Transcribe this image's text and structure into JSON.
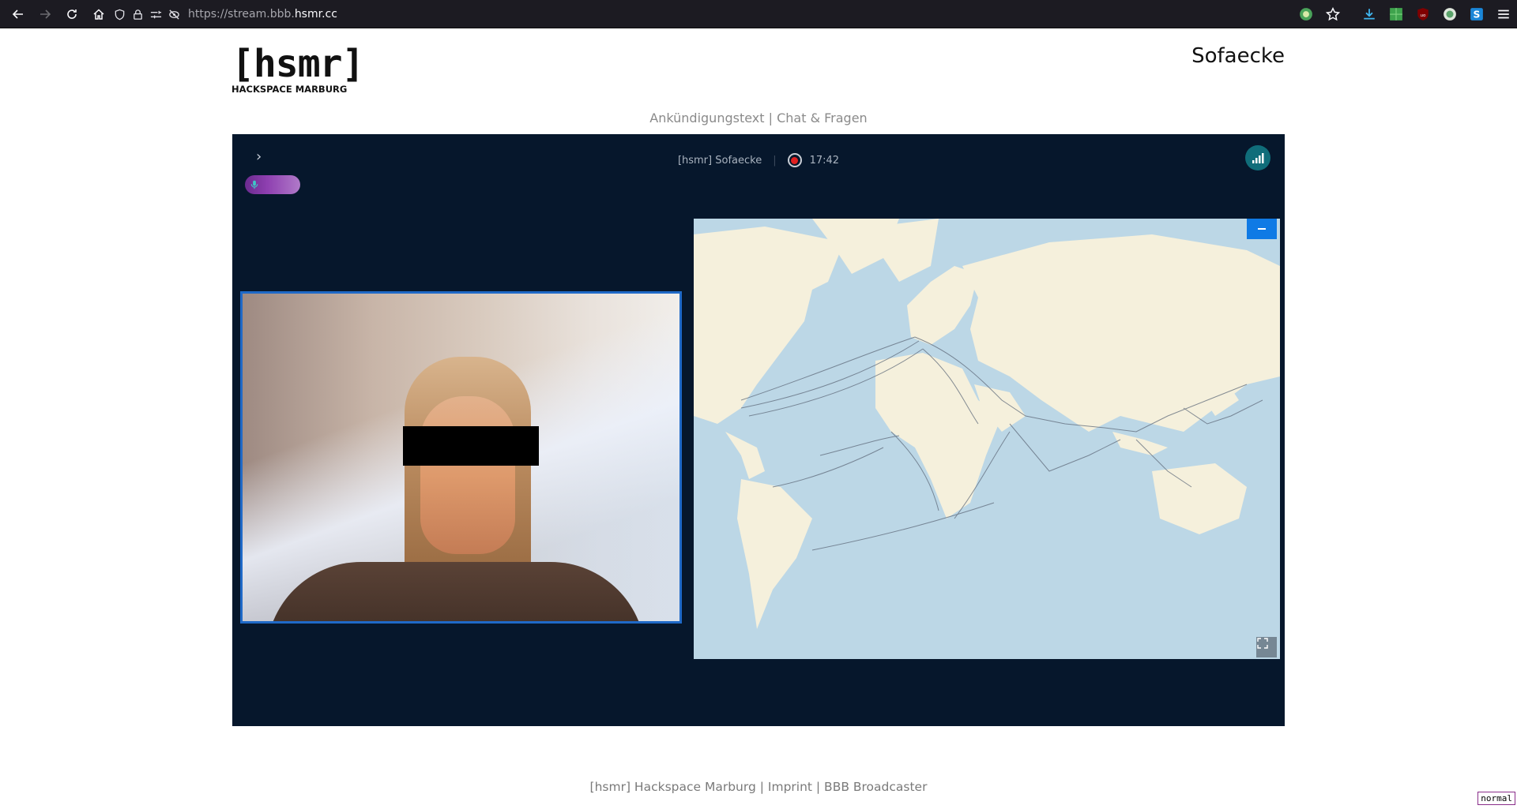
{
  "browser": {
    "url_prefix": "https://stream.bbb.",
    "url_host": "hsmr.cc"
  },
  "site": {
    "logo_mark": "[hsmr]",
    "logo_sub": "HACKSPACE MARBURG",
    "room_title": "Sofaecke"
  },
  "subnav": {
    "item1": "Ankündigungstext",
    "separator": " | ",
    "item2": "Chat & Fragen"
  },
  "stream": {
    "meeting_name": "[hsmr] Sofaecke",
    "recording_time": "17:42",
    "recording_color": "#e02020",
    "connection_color": "#106d7a"
  },
  "footer": {
    "text": "[hsmr] Hackspace Marburg | Imprint | BBB Broadcaster"
  },
  "badge": {
    "mode": "normal"
  },
  "icons": {
    "back": "arrow-left-icon",
    "forward": "arrow-right-icon",
    "reload": "reload-icon",
    "home": "home-icon",
    "shield": "shield-icon",
    "lock": "lock-icon",
    "permissions": "permissions-icon",
    "tracking": "tracking-off-icon",
    "bookmark": "star-icon",
    "download": "download-icon",
    "menu": "hamburger-icon"
  }
}
